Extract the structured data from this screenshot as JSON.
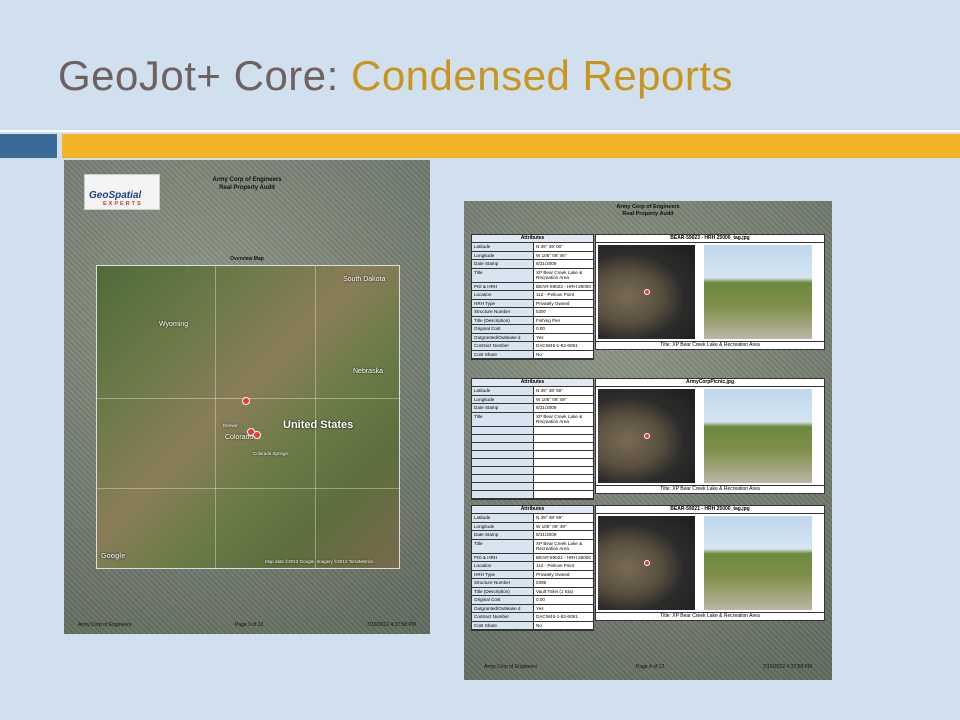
{
  "slide": {
    "title_main": "GeoJot+ Core:",
    "title_accent": "Condensed Reports"
  },
  "report_map": {
    "header_line1": "Army Corp of Engineers",
    "header_line2": "Real Property Audit",
    "logo_text": "GeoSpatial",
    "logo_subtext": "EXPERTS",
    "map_title": "Overview Map",
    "labels": {
      "united_states": "United States",
      "wyoming": "Wyoming",
      "south_dakota": "South Dakota",
      "nebraska": "Nebraska",
      "colorado": "Colorado",
      "denver": "Denver",
      "colorado_springs": "Colorado Springs",
      "google": "Google",
      "credits": "Map data ©2012 Google, Imagery ©2012 TerraMetrics"
    },
    "footer_left": "Army Corp of Engineers",
    "footer_center": "Page 3 of 12",
    "footer_right": "7/10/2012 4:37:58 PM"
  },
  "report_detail": {
    "header_line1": "Army Corp of Engineers",
    "header_line2": "Real Property Audit",
    "attributes_heading": "Attributes",
    "records": [
      {
        "photo_title": "BEAR-59023 - HRH 25000_tag.jpg",
        "caption": "Title: XP Bear Creek Lake & Recreation Area",
        "rows": [
          [
            "Latitude",
            "N 39° 39' 00\""
          ],
          [
            "Longitude",
            "W 105° 08' 46\""
          ],
          [
            "Date Stamp",
            "8/31/2009"
          ],
          [
            "Title",
            "XP Bear Creek Lake & Recreation Area"
          ],
          [
            "PID & HRH",
            "BEAR-59023 - HRH 25000"
          ],
          [
            "Location",
            "112 - Pelican Point"
          ],
          [
            "HRH Type",
            "Privately Owned"
          ],
          [
            "Structure Number",
            "5397"
          ],
          [
            "Title (Description)",
            "Fishing Pier"
          ],
          [
            "Original Cost",
            "0.00"
          ],
          [
            "Outgranted/Outlease d",
            "Yes"
          ],
          [
            "Contract Number",
            "DACW45-1-82-6091"
          ],
          [
            "Cost Share",
            "No"
          ]
        ]
      },
      {
        "photo_title": "ArmyCorpPicnic.jpg",
        "caption": "Title: XP Bear Creek Lake & Recreation Area",
        "rows": [
          [
            "Latitude",
            "N 39° 38' 59\""
          ],
          [
            "Longitude",
            "W 105° 08' 49\""
          ],
          [
            "Date Stamp",
            "8/31/2009"
          ],
          [
            "Title",
            "XP Bear Creek Lake & Recreation Area"
          ],
          [
            "",
            ""
          ],
          [
            "",
            ""
          ],
          [
            "",
            ""
          ],
          [
            "",
            ""
          ],
          [
            "",
            ""
          ],
          [
            "",
            ""
          ],
          [
            "",
            ""
          ],
          [
            "",
            ""
          ],
          [
            "",
            ""
          ]
        ]
      },
      {
        "photo_title": "BEAR-59021 - HRH 25000_tag.jpg",
        "caption": "Title: XP Bear Creek Lake & Recreation Area",
        "rows": [
          [
            "Latitude",
            "N 39° 38' 59\""
          ],
          [
            "Longitude",
            "W 105° 08' 49\""
          ],
          [
            "Date Stamp",
            "8/31/2009"
          ],
          [
            "Title",
            "XP Bear Creek Lake & Recreation Area"
          ],
          [
            "PID & HRH",
            "BEAR-59021 - HRH 25000"
          ],
          [
            "Location",
            "112 - Pelican Point"
          ],
          [
            "HRH Type",
            "Privately Owned"
          ],
          [
            "Structure Number",
            "5395"
          ],
          [
            "Title (Description)",
            "Vault Toilet (1 Sta)"
          ],
          [
            "Original Cost",
            "0.00"
          ],
          [
            "Outgranted/Outlease d",
            "Yes"
          ],
          [
            "Contract Number",
            "DACW45-1-82-6091"
          ],
          [
            "Cost Share",
            "No"
          ]
        ]
      }
    ],
    "footer_left": "Army Corp of Engineers",
    "footer_center": "Page 4 of 12",
    "footer_right": "7/10/2012 4:37:58 PM"
  },
  "colors": {
    "background": "#d0e0ee",
    "title_gray": "#6e6160",
    "title_gold": "#c9951c",
    "bar_blue": "#3a6b97",
    "bar_gold": "#f2b424"
  }
}
